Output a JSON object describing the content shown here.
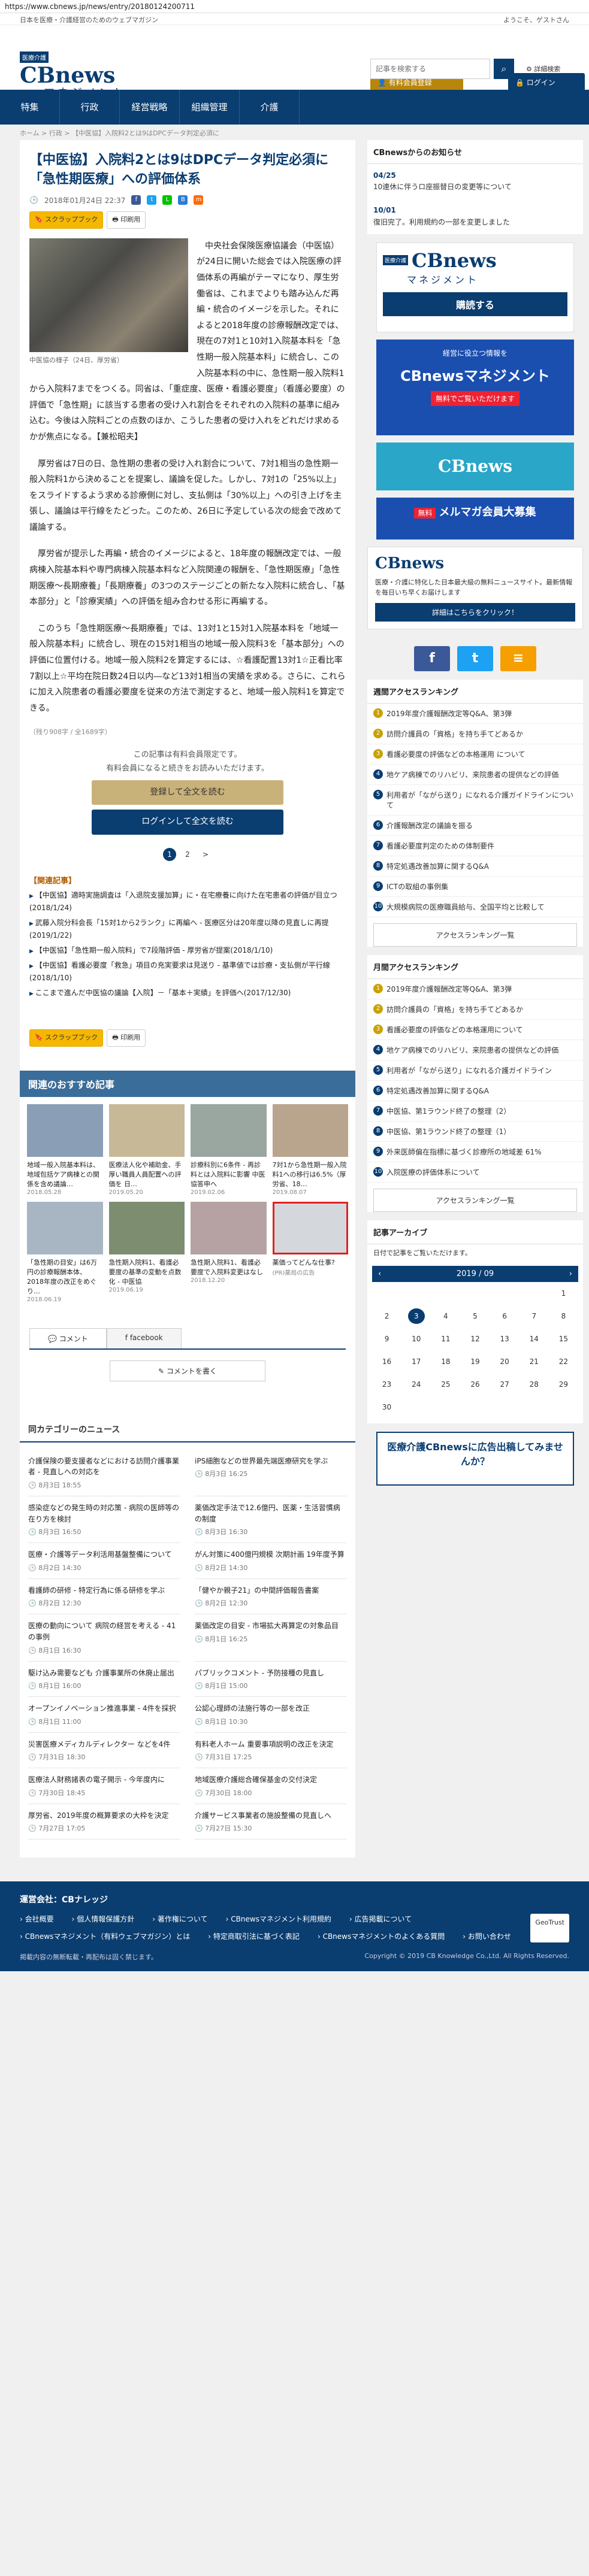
{
  "browser": {
    "url": "https://www.cbnews.jp/news/entry/20180124200711"
  },
  "topbar": {
    "tagline": "日本を医療・介護経営のためのウェブマガジン",
    "welcome": "ようこそ、ゲストさん"
  },
  "header": {
    "logo_badge": "医療介護",
    "logo_text": "CBnews",
    "logo_sub": "マネジメント",
    "btn_paid": "有料会員登録",
    "btn_login": "ログイン"
  },
  "nav": {
    "items": [
      "特集",
      "行政",
      "経営戦略",
      "組織管理",
      "介護"
    ]
  },
  "search": {
    "placeholder": "記事を検索する",
    "detail": "詳細検索"
  },
  "breadcrumb": "ホーム > 行政 > 【中医協】入院料2とは9はDPCデータ判定必須に",
  "article": {
    "title": "【中医協】入院料2とは9はDPCデータ判定必須に「急性期医療」への評価体系",
    "date": "2018年01月24日 22:37",
    "bookmark": "スクラップブック",
    "print": "印刷用",
    "photo_caption": "中医協の様子（24日、厚労省）",
    "paras": [
      "中央社会保険医療協議会（中医協）が24日に開いた総会では入院医療の評価体系の再編がテーマになり、厚生労働省は、これまでよりも踏み込んだ再編・統合のイメージを示した。それによると2018年度の診療報酬改定では、現在の7対1と10対1入院基本料を「急性期一般入院基本料」に統合し、この入院基本料の中に、急性期一般入院料1から入院料7までをつくる。同省は、「重症度、医療・看護必要度」（看護必要度）の評価で「急性期」に該当する患者の受け入れ割合をそれぞれの入院料の基準に組み込む。今後は入院料ごとの点数のほか、こうした患者の受け入れをどれだけ求めるかが焦点になる。【兼松昭夫】",
      "厚労省は7日の日、急性期の患者の受け入れ割合について、7対1相当の急性期一般入院料1から決めることを提案し、議論を促した。しかし、7対1の「25%以上」をスライドするよう求める診療側に対し、支払側は「30%以上」への引き上げを主張し、議論は平行線をたどった。このため、26日に予定している次の総会で改めて議論する。",
      "厚労省が提示した再編・統合のイメージによると、18年度の報酬改定では、一般病棟入院基本料や専門病棟入院基本料など入院関連の報酬を、「急性期医療」「急性期医療～長期療養」「長期療養」の3つのステージごとの新たな入院料に統合し、「基本部分」と「診療実績」への評価を組み合わせる形に再編する。",
      "このうち「急性期医療～長期療養」では、13対1と15対1入院基本料を「地域一般入院基本料」に統合し、現在の15対1相当の地域一般入院料3を「基本部分」への評価に位置付ける。地域一般入院料2を算定するには、☆看護配置13対1☆正看比率7割以上☆平均在院日数24日以内―など13対1相当の実績を求める。さらに、これらに加え入院患者の看護必要度を従来の方法で測定すると、地域一般入院料1を算定できる。"
    ],
    "chars": "（残り908字 / 全1689字）",
    "pay_msg1": "この記事は有料会員限定です。",
    "pay_msg2": "有料会員になると続きをお読みいただけます。",
    "pay_btn1": "登録して全文を読む",
    "pay_btn2": "ログインして全文を読む",
    "pages": [
      "1",
      "2",
      ">"
    ],
    "related_title": "【関連記事】",
    "related": [
      "【中医協】適時実施調査は「入退院支援加算」に・在宅療養に向けた在宅患者の評価が目立つ(2018/1/24)",
      "武藤入院分科会長「15対1から2ランク」に再編へ - 医療区分は20年度以降の見直しに再提(2019/1/22)",
      "【中医協】「急性期一般入院料」で7段階評価 - 厚労省が提案(2018/1/10)",
      "【中医協】看護必要度「救急」項目の充実要求は見送り - 基準値では診療・支払側が平行線(2018/1/10)",
      "ここまで進んだ中医協の議論【入院】－「基本＋実績」を評価へ(2017/12/30)"
    ]
  },
  "recommend": {
    "title": "関連のおすすめ記事",
    "items": [
      {
        "t": "地域一般入院基本料は、地域包括ケア病棟との関係を含め議論…",
        "d": "2018.05.28"
      },
      {
        "t": "医療法人化や補助金、手厚い職員人員配置への評価を 日…",
        "d": "2019.05.20"
      },
      {
        "t": "診療科別に6条件 - 再診料とは入院料に影響 中医協答申へ",
        "d": "2019.02.06"
      },
      {
        "t": "7対1から急性期一般入院料1への移行は6.5%（厚労省、18…",
        "d": "2019.08.07"
      },
      {
        "t": "「急性期の目安」は6万円の診療報酬本体、2018年度の改正をめぐり…",
        "d": "2018.06.19"
      },
      {
        "t": "急性期入院料1、看護必要度の基準の変動を点数化 - 中医協",
        "d": "2019.06.19"
      },
      {
        "t": "急性期入院料1、看護必要度で入院料変更はなし",
        "d": "2018.12.20"
      },
      {
        "t": "薬価ってどんな仕事?",
        "d": "(PR)薬局の広告"
      }
    ]
  },
  "comments": {
    "tab1": "コメント",
    "tab2": "facebook",
    "write": "コメントを書く"
  },
  "catnews": {
    "title": "同カテゴリーのニュース",
    "items": [
      {
        "t": "介護保険の要支援者などにおける訪問介護事業者 - 見直しへの対応を",
        "d": "8月3日 18:55"
      },
      {
        "t": "iPS細胞などの世界最先端医療研究を学ぶ",
        "d": "8月3日 16:25"
      },
      {
        "t": "感染症などの発生時の対応策 - 病院の医師等の在り方を検討",
        "d": "8月3日 16:50"
      },
      {
        "t": "薬価改定手法で12.6億円、医薬・生活習慣病の制度",
        "d": "8月3日 16:30"
      },
      {
        "t": "医療・介護等データ利活用基盤整備について",
        "d": "8月2日 14:30"
      },
      {
        "t": "がん対策に400億円規模 次期計画 19年度予算",
        "d": "8月2日 14:30"
      },
      {
        "t": "看護師の研修 - 特定行為に係る研修を学ぶ",
        "d": "8月2日 12:30"
      },
      {
        "t": "「健やか親子21」の中間評価報告書案",
        "d": "8月2日 12:30"
      },
      {
        "t": "医療の動向について 病院の経営を考える - 41の事例",
        "d": "8月1日 16:30"
      },
      {
        "t": "薬価改定の目安 - 市場拡大再算定の対象品目",
        "d": "8月1日 16:25"
      },
      {
        "t": "駆け込み需要なども 介護事業所の休廃止届出",
        "d": "8月1日 16:00"
      },
      {
        "t": "パブリックコメント - 予防接種の見直し",
        "d": "8月1日 15:00"
      },
      {
        "t": "オープンイノベーション推進事業 - 4件を採択",
        "d": "8月1日 11:00"
      },
      {
        "t": "公認心理師の法施行等の一部を改正",
        "d": "8月1日 10:30"
      },
      {
        "t": "災害医療メディカルディレクター などを4件",
        "d": "7月31日 18:30"
      },
      {
        "t": "有料老人ホーム 重要事項説明の改正を決定",
        "d": "7月31日 17:25"
      },
      {
        "t": "医療法人財務諸表の電子開示 - 今年度内に",
        "d": "7月30日 18:45"
      },
      {
        "t": "地域医療介護総合確保基金の交付決定",
        "d": "7月30日 18:00"
      },
      {
        "t": "厚労省、2019年度の概算要求の大枠を決定",
        "d": "7月27日 17:05"
      },
      {
        "t": "介護サービス事業者の施設整備の見直しへ",
        "d": "7月27日 15:30"
      }
    ]
  },
  "sidebar": {
    "notice_title": "CBnewsからのお知らせ",
    "notices": [
      {
        "d": "04/25",
        "t": "10連休に伴うロ座振替日の変更等について"
      },
      {
        "d": "10/01",
        "t": "復旧完了。利用規約の一部を変更しました"
      }
    ],
    "ad1_badge": "医療介護",
    "ad1_title": "CBnews",
    "ad1_sub": "マネジメント",
    "ad1_cta": "購読する",
    "ad2_title": "CBnewsマネジメント",
    "ad2_tag": "経営に役立つ情報を",
    "ad2_sub": "無料でご覧いただけます",
    "ad3_text": "メルマガ会員大募集",
    "ad3_sub": "無料",
    "ad4_title": "CBnews",
    "ad4_text": "医療・介護に特化した日本最大級の無料ニュースサイト。最新情報を毎日いち早くお届けします",
    "ad4_btn": "詳細はこちらをクリック！",
    "social": [
      "f",
      "t",
      "≡"
    ],
    "rank_weekly_title": "週間アクセスランキング",
    "rank_weekly": [
      "2019年度介護報酬改定等Q&A、第3弾",
      "訪問介護員の「資格」を持ち手てどあるか",
      "看護必要度の評価などの本格運用 について",
      "地ケア病棟でのリハビリ、来院患者の提供などの評価",
      "利用者が「ながら送り」になれる介護ガイドラインについて",
      "介護報酬改定の議論を振る",
      "看護必要度判定のための体制要件",
      "特定処遇改善加算に関するQ&A",
      "ICTの取組の事例集",
      "大規模病院の医療職員給与、全国平均と比較して"
    ],
    "rank_more": "アクセスランキング一覧",
    "rank_monthly_title": "月間アクセスランキング",
    "rank_monthly": [
      "2019年度介護報酬改定等Q&A、第3弾",
      "訪問介護員の「資格」を持ち手てどあるか",
      "看護必要度の評価などの本格運用について",
      "地ケア病棟でのリハビリ、来院患者の提供などの評価",
      "利用者が「ながら送り」になれる介護ガイドライン",
      "特定処遇改善加算に関するQ&A",
      "中医協、第1ラウンド終了の整理（2）",
      "中医協、第1ラウンド終了の整理（1）",
      "外来医師偏在指標に基づく診療所の地域差 61%",
      "入院医療の評価体系について"
    ],
    "archive_title": "記事アーカイブ",
    "archive_sub": "日付で記事をご覧いただけます。",
    "cal_month": "2019 / 09",
    "cal_days": [
      "",
      "",
      "",
      "",
      "",
      "",
      "1",
      "2",
      "3",
      "4",
      "5",
      "6",
      "7",
      "8",
      "9",
      "10",
      "11",
      "12",
      "13",
      "14",
      "15",
      "16",
      "17",
      "18",
      "19",
      "20",
      "21",
      "22",
      "23",
      "24",
      "25",
      "26",
      "27",
      "28",
      "29",
      "30"
    ],
    "cal_today": "3",
    "ad5_text": "医療介護CBnewsに広告出稿してみませんか？"
  },
  "footer": {
    "company": "運営会社：CBナレッジ",
    "links": [
      "会社概要",
      "個人情報保護方針",
      "著作権について",
      "CBnewsマネジメント利用規約",
      "広告掲載について",
      "CBnewsマネジメント（有料ウェブマガジン）とは",
      "特定商取引法に基づく表記",
      "CBnewsマネジメントのよくある質問",
      "お問い合わせ"
    ],
    "note": "掲載内容の無断転載・再配布は固く禁じます。",
    "copyright": "Copyright © 2019 CB Knowledge Co.,Ltd. All Rights Reserved.",
    "badge": "GeoTrust"
  },
  "colors": {
    "brand": "#0a3d70",
    "accent": "#b8860b",
    "section": "#3a6d99"
  }
}
